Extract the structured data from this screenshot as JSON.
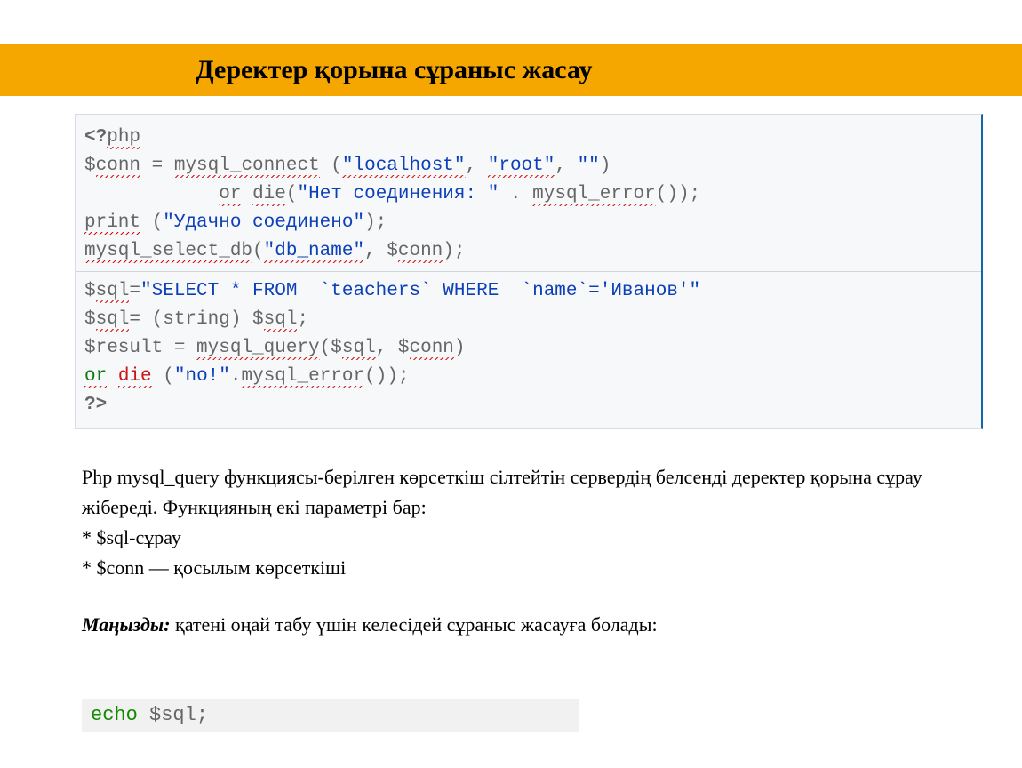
{
  "title": "Деректер қорына сұраныс жасау",
  "code": {
    "l1_open": "&lt;?",
    "l1_php": "php",
    "l2_conn": "$",
    "l2_conn2": "conn",
    "l2_eq": " = ",
    "l2_myc": "mysql_connect",
    "l2_sp": " (",
    "l2_local": "\"localhost\"",
    "l2_c1": ", ",
    "l2_root": "\"root\"",
    "l2_c2": ", ",
    "l2_emp": "\"\"",
    "l2_cp": ")",
    "l3_or": "or",
    "l3_sp": " ",
    "l3_die": "die",
    "l3_op": "(",
    "l3_str": "\"Нет соединения: \"",
    "l3_dot": " . ",
    "l3_err": "mysql_error",
    "l3_cl": "());",
    "l4_print": "print",
    "l4_rest": " (",
    "l4_str": "\"Удачно соединено\"",
    "l4_end": ");",
    "l5_sel": "mysql_select_db",
    "l5_sp": "(",
    "l5_db": "\"db_name\"",
    "l5_c": ", $",
    "l5_conn": "conn",
    "l5_end": ");",
    "l6_d": "$",
    "l6_sql": "sql",
    "l6_eq": "=",
    "l6_str": "\"SELECT * FROM  `teachers` WHERE  `name`='Иванов'\"",
    "l7_d": "$",
    "l7_sql": "sql",
    "l7_eq": "= (string) $",
    "l7_sql2": "sql",
    "l7_end": ";",
    "l8_res": "$result",
    "l8_eq": " = ",
    "l8_q": "mysql_query",
    "l8_op": "($",
    "l8_sql": "sql",
    "l8_c": ", $",
    "l8_conn": "conn",
    "l8_cp": ")",
    "l9_or": "or",
    "l9_sp": " ",
    "l9_die": "die",
    "l9_op": " (",
    "l9_str": "\"no!\"",
    "l9_dot": ".",
    "l9_err": "mysql_error",
    "l9_cl": "());",
    "l10": "?&gt;"
  },
  "para1": "Php mysql_query функциясы-берілген көрсеткіш сілтейтін сервердің белсенді деректер қорына сұрау жібереді. Функцияның екі параметрі бар:",
  "b1": "* $sql-сұрау",
  "b2": "* $conn — қосылым көрсеткіші",
  "importantLabel": "Маңызды:",
  "importantText": " қатені оңай табу үшін келесідей сұраныс  жасауға болады:",
  "echo_kw": "echo",
  "echo_rest": " $sql;"
}
